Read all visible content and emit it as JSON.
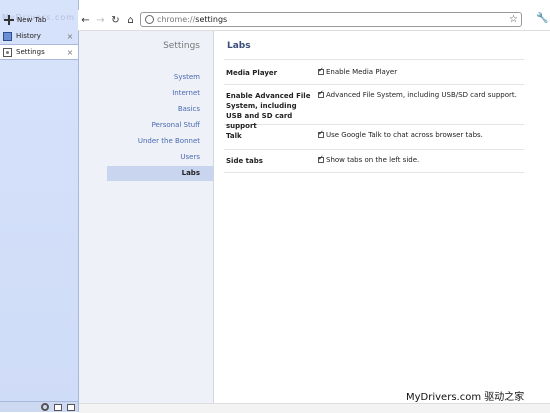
{
  "tabs": {
    "new_tab": "New Tab",
    "items": [
      {
        "label": "History",
        "close": "×"
      },
      {
        "label": "Settings",
        "close": "×"
      }
    ]
  },
  "toolbar": {
    "back_icon": "←",
    "forward_icon": "→",
    "reload_icon": "↻",
    "home_icon": "⌂",
    "url_scheme": "chrome://",
    "url_path": "settings",
    "star_icon": "☆",
    "wrench_icon": "🔧"
  },
  "sidebar": {
    "title": "Settings",
    "items": [
      {
        "label": "System"
      },
      {
        "label": "Internet"
      },
      {
        "label": "Basics"
      },
      {
        "label": "Personal Stuff"
      },
      {
        "label": "Under the Bonnet"
      },
      {
        "label": "Users"
      },
      {
        "label": "Labs",
        "selected": true
      }
    ]
  },
  "content": {
    "title": "Labs",
    "rows": [
      {
        "label": "Media Player",
        "option": "Enable Media Player",
        "checked": true
      },
      {
        "label": "Enable Advanced File System, including USB and SD card support",
        "option": "Advanced File System, including USB/SD card support.",
        "checked": true
      },
      {
        "label": "Talk",
        "option": "Use Google Talk to chat across browser tabs.",
        "checked": true
      },
      {
        "label": "Side tabs",
        "option": "Show tabs on the left side.",
        "checked": true
      }
    ]
  },
  "watermarks": {
    "top": "MyDrivers.com",
    "bottom": "MyDrivers.com 驱动之家"
  }
}
